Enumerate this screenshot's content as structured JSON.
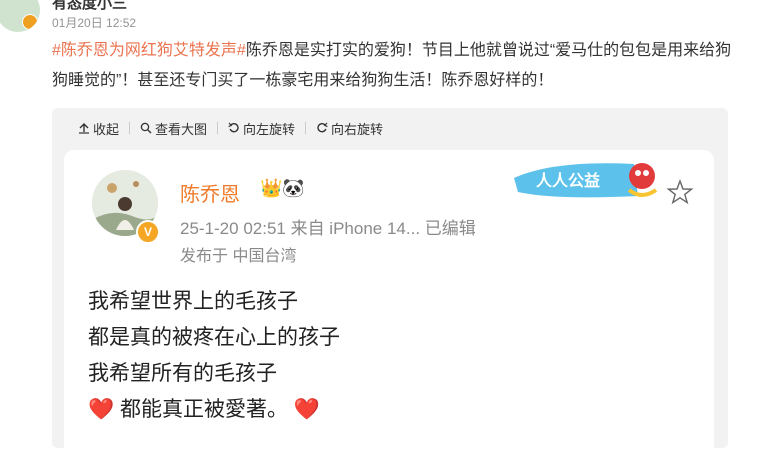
{
  "header": {
    "username": "有态度小三",
    "timestamp": "01月20日 12:52"
  },
  "post": {
    "topic": "#陈乔恩为网红狗艾特发声#",
    "text": "陈乔恩是实打实的爱狗！节目上他就曾说过“爱马仕的包包是用来给狗狗睡觉的”！甚至还专门买了一栋豪宅用来给狗狗生活！陈乔恩好样的！"
  },
  "toolbar": {
    "collapse": "收起",
    "view_large": "查看大图",
    "rotate_left": "向左旋转",
    "rotate_right": "向右旋转"
  },
  "card": {
    "name": "陈乔恩",
    "name_emojis": "👑🐼",
    "meta": "25-1-20 02:51  来自 iPhone 14...  已编辑",
    "location": "发布于  中国台湾",
    "banner_text": "人人公益",
    "lines": [
      "我希望世界上的毛孩子",
      "都是真的被疼在心上的孩子",
      "我希望所有的毛孩子",
      "都能真正被愛著。"
    ],
    "heart_emoji": "❤️"
  },
  "colors": {
    "topic": "#eb7350",
    "name_orange": "#f07b2a",
    "heart_red": "#e0202a"
  }
}
